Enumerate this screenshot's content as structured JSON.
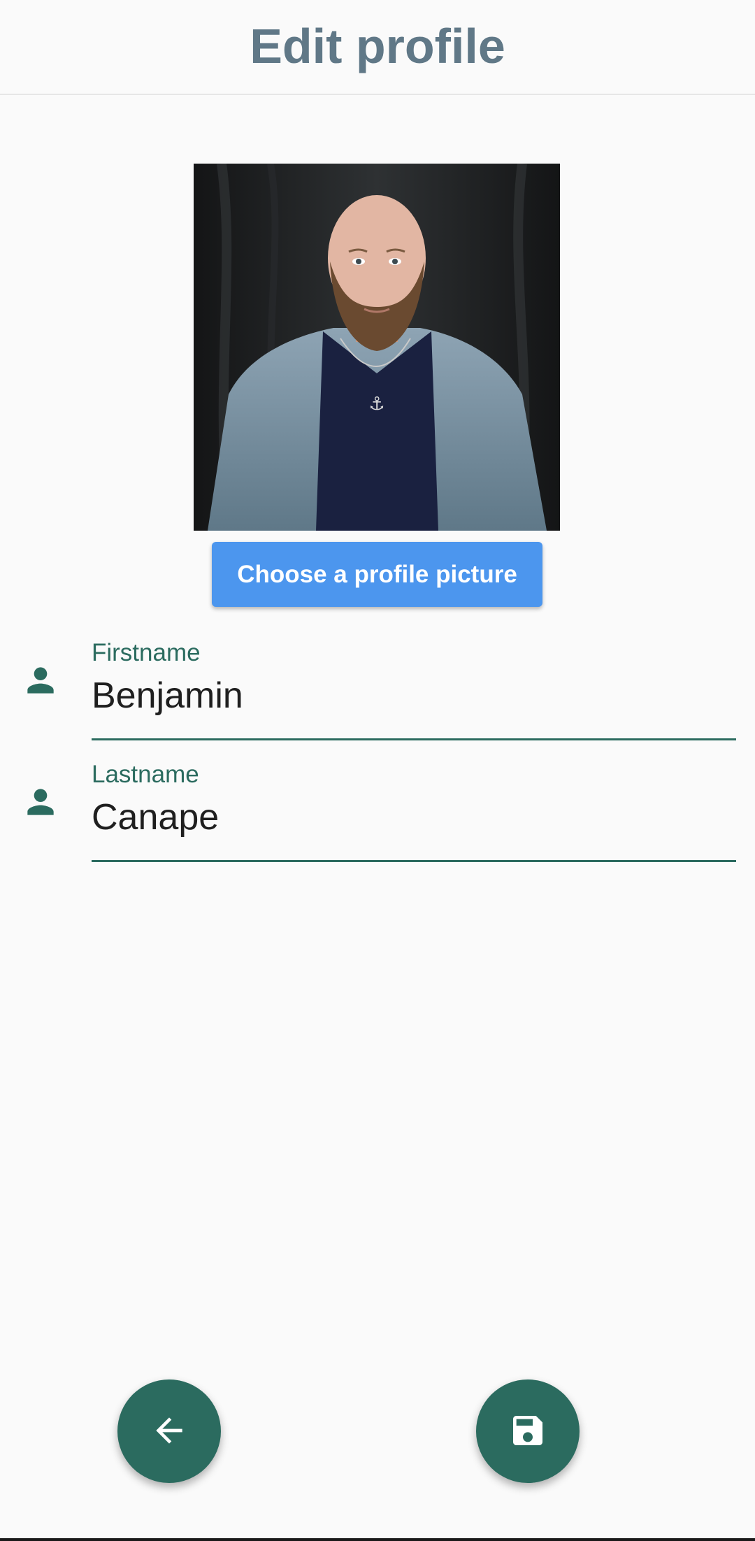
{
  "appbar": {
    "title": "Edit profile"
  },
  "profile_photo": {
    "description_icon": "profile-photo"
  },
  "choose_picture_button": {
    "label": "Choose a profile picture"
  },
  "fields": {
    "firstname": {
      "label": "Firstname",
      "value": "Benjamin",
      "icon": "person-icon"
    },
    "lastname": {
      "label": "Lastname",
      "value": "Canape",
      "icon": "person-icon"
    }
  },
  "fabs": {
    "back": {
      "icon": "arrow-back-icon"
    },
    "save": {
      "icon": "save-icon"
    }
  },
  "colors": {
    "accent": "#2b6b5f",
    "button_blue": "#4c96ee",
    "title_gray": "#607887",
    "background": "#fafafa"
  }
}
